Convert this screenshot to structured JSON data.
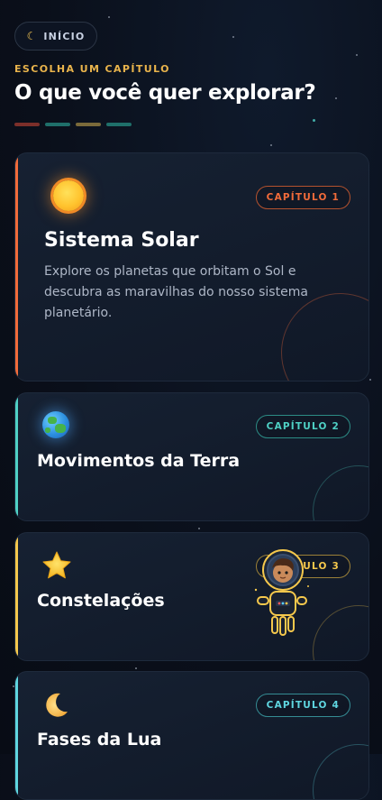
{
  "header": {
    "home_label": "INÍCIO",
    "eyebrow": "ESCOLHA UM CAPÍTULO",
    "title": "O que você quer explorar?"
  },
  "progress_colors": [
    "#7c2f2a",
    "#1f6f6a",
    "#7a6a3a",
    "#1f6f6a"
  ],
  "chapters": [
    {
      "badge": "CAPÍTULO 1",
      "title": "Sistema Solar",
      "description": "Explore os planetas que orbitam o Sol e descubra as maravilhas do nosso sistema planetário.",
      "icon": "sun-icon",
      "accent": "#f26b3a"
    },
    {
      "badge": "CAPÍTULO 2",
      "title": "Movimentos da Terra",
      "icon": "earth-icon",
      "accent": "#4fd1c5"
    },
    {
      "badge": "CAPÍTULO 3",
      "title": "Constelações",
      "icon": "star-icon",
      "accent": "#f5c84c"
    },
    {
      "badge": "CAPÍTULO 4",
      "title": "Fases da Lua",
      "icon": "crescent-moon-icon",
      "accent": "#5fd6e0"
    }
  ]
}
